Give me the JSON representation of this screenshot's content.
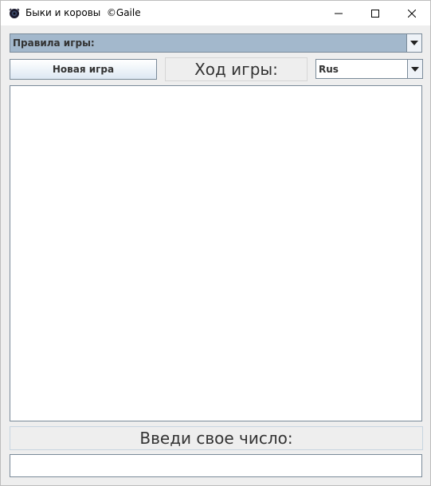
{
  "window": {
    "title": "Быки и коровы  ©Gaile",
    "app_icon": "bull-icon"
  },
  "rules": {
    "label": "Правила игры:"
  },
  "toolbar": {
    "new_game_label": "Новая игра",
    "turn_label": "Ход игры:",
    "language_value": "Rus"
  },
  "log": {
    "content": ""
  },
  "input": {
    "prompt_label": "Введи свое число:",
    "value": ""
  },
  "colors": {
    "combo_selected_bg": "#a3b8cc",
    "border": "#7a8a99",
    "background": "#eeeeee"
  }
}
